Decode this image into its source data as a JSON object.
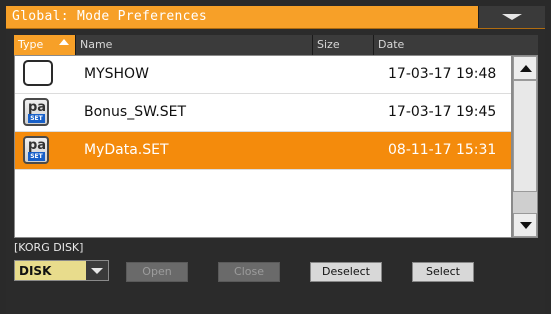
{
  "titlebar": {
    "title": "Global: Mode Preferences"
  },
  "columns": {
    "type": "Type",
    "name": "Name",
    "size": "Size",
    "date": "Date"
  },
  "files": [
    {
      "icon": "folder-icon",
      "name": "MYSHOW",
      "date": "17-03-17 19:48",
      "selected": false
    },
    {
      "icon": "pa-set-icon",
      "name": "Bonus_SW.SET",
      "date": "17-03-17 19:45",
      "selected": false
    },
    {
      "icon": "pa-set-icon",
      "name": "MyData.SET",
      "date": "08-11-17 15:31",
      "selected": true
    }
  ],
  "icon_text": {
    "pa": "pa",
    "set": "SET"
  },
  "path": "[KORG DISK]",
  "device": {
    "selected": "DISK"
  },
  "buttons": {
    "open": "Open",
    "close": "Close",
    "deselect": "Deselect",
    "select": "Select"
  },
  "colors": {
    "accent": "#f7a028",
    "selection": "#f48b0c"
  }
}
